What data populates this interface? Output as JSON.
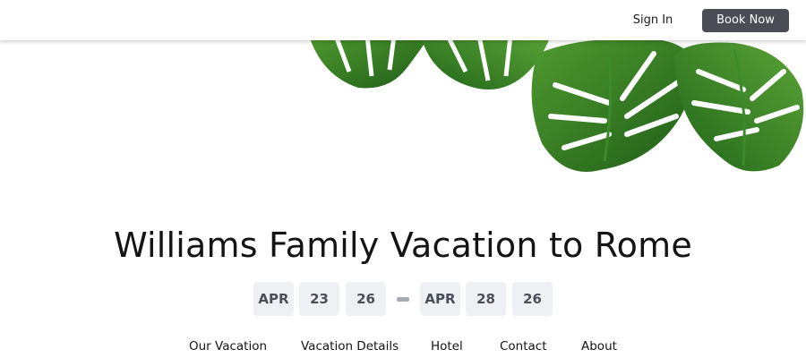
{
  "header": {
    "sign_in_label": "Sign In",
    "book_now_label": "Book Now"
  },
  "hero": {
    "title": "Williams Family Vacation to Rome"
  },
  "dates": {
    "start": {
      "month": "APR",
      "day": "23",
      "year": "26"
    },
    "end": {
      "month": "APR",
      "day": "28",
      "year": "26"
    }
  },
  "nav": {
    "items": [
      {
        "label": "Our Vacation"
      },
      {
        "label": "Vacation Details"
      },
      {
        "label": "Hotel"
      },
      {
        "label": "Contact"
      },
      {
        "label": "About"
      }
    ]
  },
  "colors": {
    "button_bg": "#4a4d55",
    "date_box_bg": "#eef0f3",
    "leaf_green": "#2f7d22"
  }
}
